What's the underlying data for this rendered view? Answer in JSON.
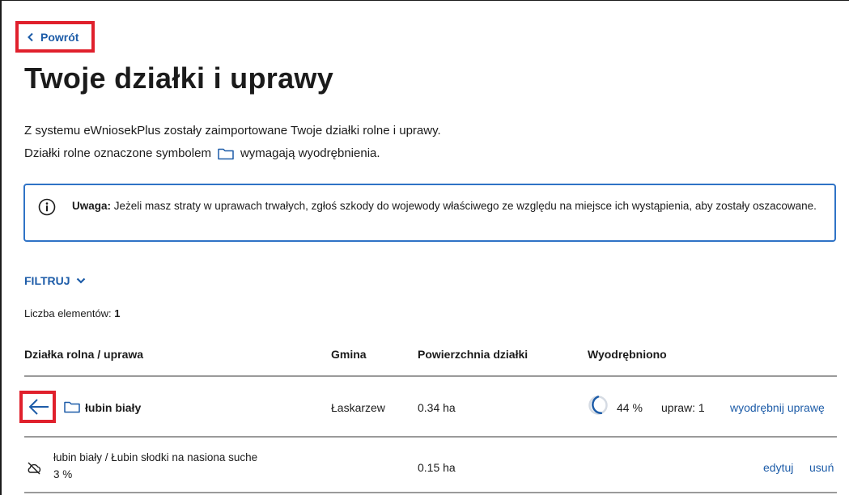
{
  "nav": {
    "back_label": "Powrót"
  },
  "page": {
    "title": "Twoje działki i uprawy",
    "intro_line1": "Z systemu eWniosekPlus zostały zaimportowane Twoje działki rolne i uprawy.",
    "intro_line2_before": "Działki rolne oznaczone symbolem",
    "intro_line2_after": "wymagają wyodrębnienia."
  },
  "alert": {
    "label": "Uwaga:",
    "text": "Jeżeli masz straty w uprawach trwałych, zgłoś szkody do wojewody właściwego ze względu na miejsce ich wystąpienia, aby zostały oszacowane."
  },
  "filter": {
    "label": "FILTRUJ"
  },
  "count": {
    "label": "Liczba elementów:",
    "value": "1"
  },
  "table": {
    "headers": {
      "name": "Działka rolna / uprawa",
      "gmina": "Gmina",
      "area": "Powierzchnia działki",
      "extracted": "Wyodrębniono"
    },
    "parcel": {
      "name": "łubin biały",
      "gmina": "Łaskarzew",
      "area": "0.34 ha",
      "percent_label": "44 %",
      "percent_value": 0.44,
      "crops_label": "upraw: 1",
      "action": "wyodrębnij uprawę"
    },
    "crop": {
      "name": "łubin biały / Łubin słodki na nasiona suche",
      "percent": "3 %",
      "area": "0.15 ha",
      "edit": "edytuj",
      "delete": "usuń"
    }
  },
  "icons": {
    "back": "chevron-left-icon",
    "folder": "folder-icon",
    "info": "info-circle-icon",
    "filter_toggle": "chevron-down-icon",
    "expand": "arrow-left-icon",
    "progress": "progress-ring-icon",
    "crop": "no-cloud-icon"
  },
  "colors": {
    "accent": "#1d5ca8",
    "highlight": "#e0202c",
    "alert_border": "#2f73c6"
  }
}
